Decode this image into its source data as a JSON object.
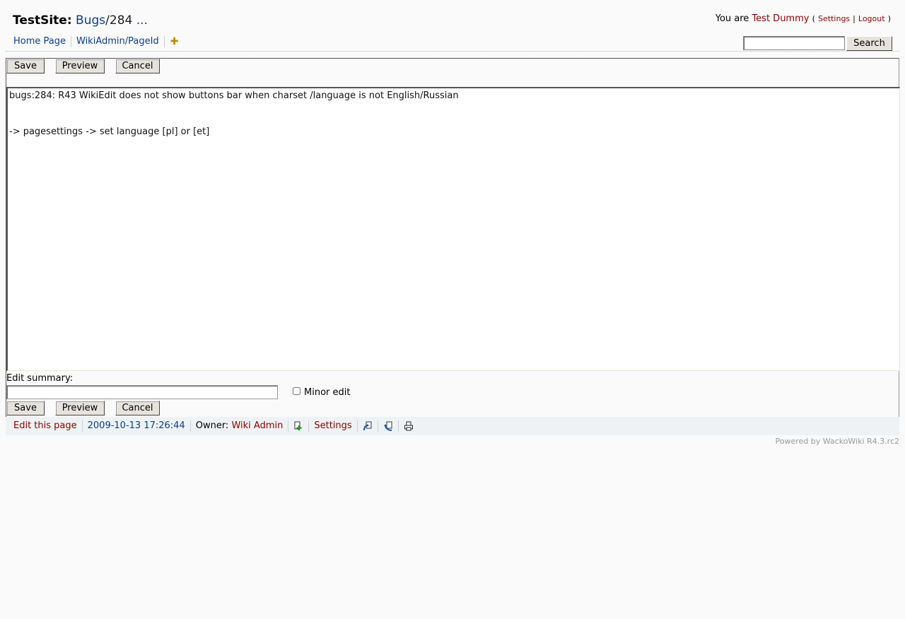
{
  "header": {
    "site_name": "TestSite:",
    "crumb_link": "Bugs",
    "crumb_sep": "/",
    "crumb_num": "284",
    "ellipsis": "...",
    "user_prefix": "You are",
    "user_name": "Test Dummy",
    "paren_open": "(",
    "settings_link": "Settings",
    "sep": "|",
    "logout_link": "Logout",
    "paren_close": ")"
  },
  "nav": {
    "items": [
      "Home Page",
      "WikiAdmin/PageId"
    ],
    "add_icon": "add-page-icon"
  },
  "search": {
    "value": "",
    "button_label": "Search"
  },
  "form": {
    "save_label": "Save",
    "preview_label": "Preview",
    "cancel_label": "Cancel",
    "body": "bugs:284: R43 WikiEdit does not show buttons bar when charset /language is not English/Russian\n\n\n-> pagesettings -> set language [pl] or [et]",
    "summary_label": "Edit summary:",
    "summary_value": "",
    "minor_edit_label": "Minor edit",
    "minor_edit_checked": false
  },
  "footer": {
    "edit_link": "Edit this page",
    "timestamp": "2009-10-13 17:26:44",
    "owner_label": "Owner:",
    "owner_name": "Wiki Admin",
    "settings_link": "Settings",
    "icons": [
      "add-watch-icon",
      "revisions-icon",
      "referrers-icon",
      "print-icon"
    ],
    "powered_by": "Powered by WackoWiki R4.3.rc2"
  },
  "colors": {
    "link_blue": "#0a3e8a",
    "link_red": "#8b0000",
    "footer_bg": "#eef2f4"
  }
}
